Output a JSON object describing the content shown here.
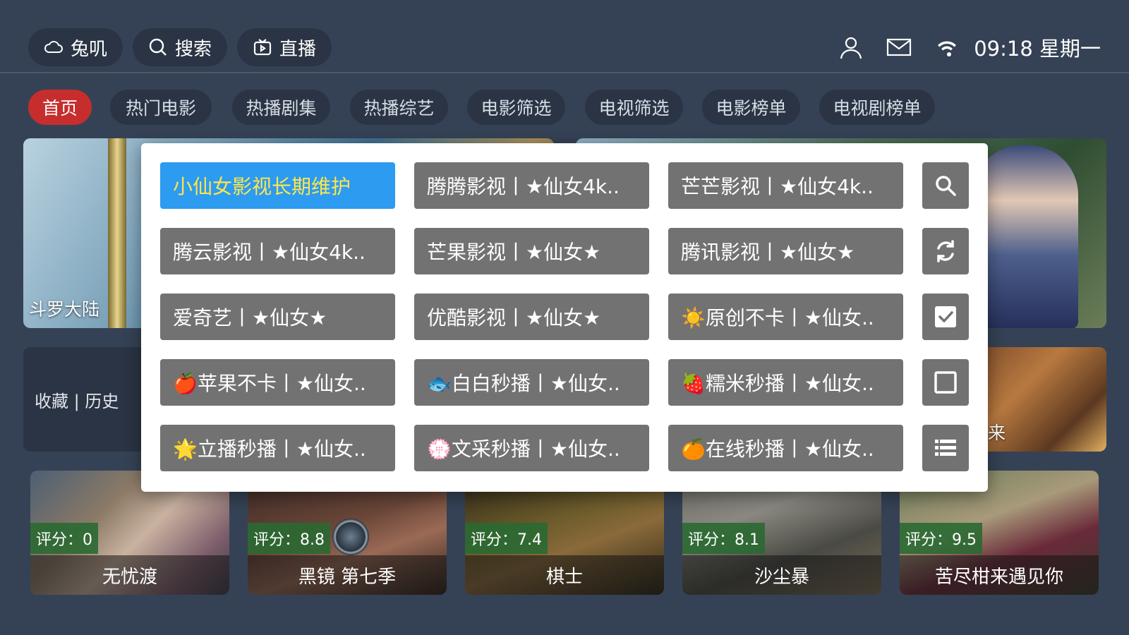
{
  "topbar": {
    "nav": [
      {
        "label": "兔叽",
        "icon": "cloud-icon"
      },
      {
        "label": "搜索",
        "icon": "search-icon"
      },
      {
        "label": "直播",
        "icon": "tv-icon"
      }
    ],
    "icons": [
      "user-icon",
      "mail-icon",
      "wifi-icon"
    ],
    "clock": "09:18 星期一"
  },
  "tabs": [
    "首页",
    "热门电影",
    "热播剧集",
    "热播综艺",
    "电影筛选",
    "电视筛选",
    "电影榜单",
    "电视剧榜单"
  ],
  "active_tab": "首页",
  "banner": {
    "left_title": "斗罗大陆"
  },
  "history_label": "收藏 | 历史",
  "right_card_text": "来",
  "movies": [
    {
      "rating": "评分：0",
      "title": "无忧渡"
    },
    {
      "rating": "评分：8.8",
      "title": "黑镜 第七季"
    },
    {
      "rating": "评分：7.4",
      "title": "棋士"
    },
    {
      "rating": "评分：8.1",
      "title": "沙尘暴"
    },
    {
      "rating": "评分：9.5",
      "title": "苦尽柑来遇见你"
    }
  ],
  "dialog": {
    "sources": [
      [
        "小仙女影视长期维护",
        "腾腾影视丨★仙女4k..",
        "芒芒影视丨★仙女4k.."
      ],
      [
        "腾云影视丨★仙女4k..",
        "芒果影视丨★仙女★",
        "腾讯影视丨★仙女★"
      ],
      [
        "爱奇艺丨★仙女★",
        "优酷影视丨★仙女★",
        "☀️原创不卡丨★仙女.."
      ],
      [
        "🍎苹果不卡丨★仙女..",
        "🐟白白秒播丨★仙女..",
        "🍓糯米秒播丨★仙女.."
      ],
      [
        "🌟立播秒播丨★仙女..",
        "💮文采秒播丨★仙女..",
        "🍊在线秒播丨★仙女.."
      ]
    ],
    "selected": "小仙女影视长期维护",
    "actions": [
      "search-icon",
      "refresh-icon",
      "checkbox-checked-icon",
      "checkbox-empty-icon",
      "list-icon"
    ]
  },
  "colors": {
    "background": "#354255",
    "pill": "#2a3444",
    "active_tab": "#c62d2d",
    "source_button": "#727272",
    "source_selected": "#2d9bf0",
    "source_selected_text": "#ffe64a",
    "rating_badge": "#2a6932"
  }
}
